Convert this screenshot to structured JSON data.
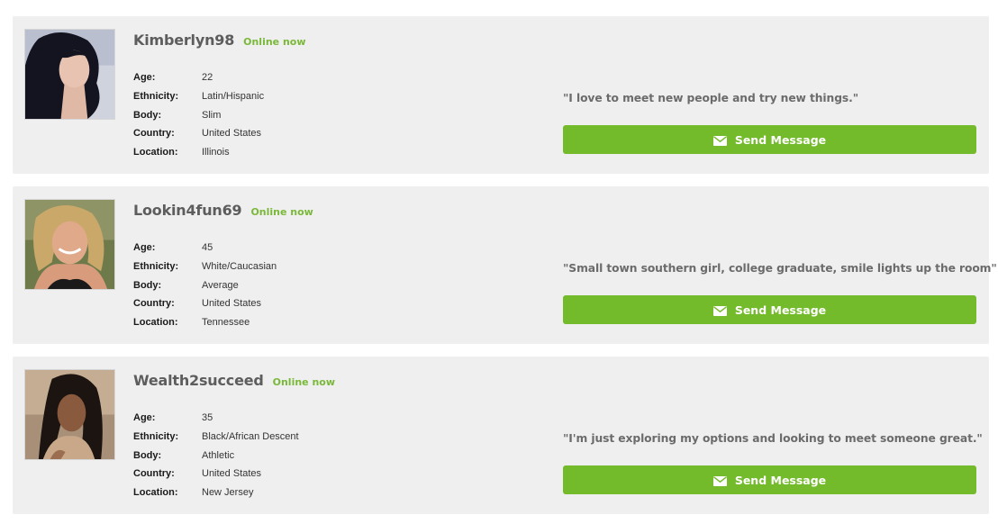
{
  "profiles": [
    {
      "username": "Kimberlyn98",
      "status": "Online now",
      "details": [
        {
          "label": "Age:",
          "value": "22"
        },
        {
          "label": "Ethnicity:",
          "value": "Latin/Hispanic"
        },
        {
          "label": "Body:",
          "value": "Slim"
        },
        {
          "label": "Country:",
          "value": "United States"
        },
        {
          "label": "Location:",
          "value": "Illinois"
        }
      ],
      "quote": "\"I love to meet new people and try new things.\"",
      "button_label": "Send Message"
    },
    {
      "username": "Lookin4fun69",
      "status": "Online now",
      "details": [
        {
          "label": "Age:",
          "value": "45"
        },
        {
          "label": "Ethnicity:",
          "value": "White/Caucasian"
        },
        {
          "label": "Body:",
          "value": "Average"
        },
        {
          "label": "Country:",
          "value": "United States"
        },
        {
          "label": "Location:",
          "value": "Tennessee"
        }
      ],
      "quote": "\"Small town southern girl, college graduate, smile lights up the room\"",
      "button_label": "Send Message"
    },
    {
      "username": "Wealth2succeed",
      "status": "Online now",
      "details": [
        {
          "label": "Age:",
          "value": "35"
        },
        {
          "label": "Ethnicity:",
          "value": "Black/African Descent"
        },
        {
          "label": "Body:",
          "value": "Athletic"
        },
        {
          "label": "Country:",
          "value": "United States"
        },
        {
          "label": "Location:",
          "value": "New Jersey"
        }
      ],
      "quote": "\"I'm just exploring my options and looking to meet someone great.\"",
      "button_label": "Send Message"
    }
  ],
  "icons": {
    "send": "envelope-icon"
  },
  "colors": {
    "online": "#7ab83a",
    "button": "#74bb2c",
    "card_bg": "#efefef"
  }
}
